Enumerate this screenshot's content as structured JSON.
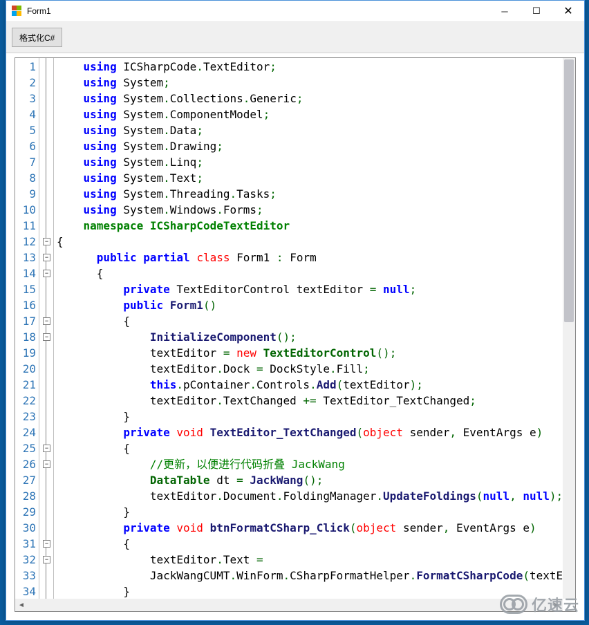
{
  "window": {
    "title": "Form1"
  },
  "toolbar": {
    "format_btn": "格式化C#"
  },
  "watermark": "亿速云",
  "line_numbers": [
    1,
    2,
    3,
    4,
    5,
    6,
    7,
    8,
    9,
    10,
    11,
    12,
    13,
    14,
    15,
    16,
    17,
    18,
    19,
    20,
    21,
    22,
    23,
    24,
    25,
    26,
    27,
    28,
    29,
    30,
    31,
    32,
    33,
    34
  ],
  "folds": [
    {
      "line": 12,
      "sym": "−"
    },
    {
      "line": 13,
      "sym": "−"
    },
    {
      "line": 14,
      "sym": "−"
    },
    {
      "line": 17,
      "sym": "−"
    },
    {
      "line": 18,
      "sym": "−"
    },
    {
      "line": 25,
      "sym": "−"
    },
    {
      "line": 26,
      "sym": "−"
    },
    {
      "line": 31,
      "sym": "−"
    },
    {
      "line": 32,
      "sym": "−"
    }
  ],
  "code": [
    [
      [
        "    "
      ],
      [
        "kw",
        "using"
      ],
      [
        " ICSharpCode"
      ],
      [
        "op",
        "."
      ],
      [
        "TextEditor"
      ],
      [
        "op",
        ";"
      ]
    ],
    [
      [
        "    "
      ],
      [
        "kw",
        "using"
      ],
      [
        " System"
      ],
      [
        "op",
        ";"
      ]
    ],
    [
      [
        "    "
      ],
      [
        "kw",
        "using"
      ],
      [
        " System"
      ],
      [
        "op",
        "."
      ],
      [
        "Collections"
      ],
      [
        "op",
        "."
      ],
      [
        "Generic"
      ],
      [
        "op",
        ";"
      ]
    ],
    [
      [
        "    "
      ],
      [
        "kw",
        "using"
      ],
      [
        " System"
      ],
      [
        "op",
        "."
      ],
      [
        "ComponentModel"
      ],
      [
        "op",
        ";"
      ]
    ],
    [
      [
        "    "
      ],
      [
        "kw",
        "using"
      ],
      [
        " System"
      ],
      [
        "op",
        "."
      ],
      [
        "Data"
      ],
      [
        "op",
        ";"
      ]
    ],
    [
      [
        "    "
      ],
      [
        "kw",
        "using"
      ],
      [
        " System"
      ],
      [
        "op",
        "."
      ],
      [
        "Drawing"
      ],
      [
        "op",
        ";"
      ]
    ],
    [
      [
        "    "
      ],
      [
        "kw",
        "using"
      ],
      [
        " System"
      ],
      [
        "op",
        "."
      ],
      [
        "Linq"
      ],
      [
        "op",
        ";"
      ]
    ],
    [
      [
        "    "
      ],
      [
        "kw",
        "using"
      ],
      [
        " System"
      ],
      [
        "op",
        "."
      ],
      [
        "Text"
      ],
      [
        "op",
        ";"
      ]
    ],
    [
      [
        "    "
      ],
      [
        "kw",
        "using"
      ],
      [
        " System"
      ],
      [
        "op",
        "."
      ],
      [
        "Threading"
      ],
      [
        "op",
        "."
      ],
      [
        "Tasks"
      ],
      [
        "op",
        ";"
      ]
    ],
    [
      [
        "    "
      ],
      [
        "kw",
        "using"
      ],
      [
        " System"
      ],
      [
        "op",
        "."
      ],
      [
        "Windows"
      ],
      [
        "op",
        "."
      ],
      [
        "Forms"
      ],
      [
        "op",
        ";"
      ]
    ],
    [
      [
        "    "
      ],
      [
        "ns",
        "namespace"
      ],
      [
        " "
      ],
      [
        "kw2",
        "ICSharpCodeTextEditor"
      ]
    ],
    [
      [
        "{"
      ]
    ],
    [
      [
        "      "
      ],
      [
        "kw",
        "public"
      ],
      [
        " "
      ],
      [
        "kw",
        "partial"
      ],
      [
        " "
      ],
      [
        "cls",
        "class"
      ],
      [
        " Form1 "
      ],
      [
        "op",
        ":"
      ],
      [
        " Form"
      ]
    ],
    [
      [
        "      {"
      ]
    ],
    [
      [
        "          "
      ],
      [
        "kw",
        "private"
      ],
      [
        " TextEditorControl textEditor "
      ],
      [
        "op",
        "="
      ],
      [
        " "
      ],
      [
        "kw",
        "null"
      ],
      [
        "op",
        ";"
      ]
    ],
    [
      [
        "          "
      ],
      [
        "kw",
        "public"
      ],
      [
        " "
      ],
      [
        "mtd",
        "Form1"
      ],
      [
        "op",
        "()"
      ]
    ],
    [
      [
        "          {"
      ]
    ],
    [
      [
        "              "
      ],
      [
        "mtd",
        "InitializeComponent"
      ],
      [
        "op",
        "();"
      ]
    ],
    [
      [
        "              textEditor "
      ],
      [
        "op",
        "="
      ],
      [
        " "
      ],
      [
        "cls",
        "new"
      ],
      [
        " "
      ],
      [
        "type",
        "TextEditorControl"
      ],
      [
        "op",
        "();"
      ]
    ],
    [
      [
        "              textEditor"
      ],
      [
        "op",
        "."
      ],
      [
        "Dock "
      ],
      [
        "op",
        "="
      ],
      [
        " DockStyle"
      ],
      [
        "op",
        "."
      ],
      [
        "Fill"
      ],
      [
        "op",
        ";"
      ]
    ],
    [
      [
        "              "
      ],
      [
        "kw",
        "this"
      ],
      [
        "op",
        "."
      ],
      [
        "pContainer"
      ],
      [
        "op",
        "."
      ],
      [
        "Controls"
      ],
      [
        "op",
        "."
      ],
      [
        "mtd",
        "Add"
      ],
      [
        "op",
        "("
      ],
      [
        "textEditor"
      ],
      [
        "op",
        ");"
      ]
    ],
    [
      [
        "              textEditor"
      ],
      [
        "op",
        "."
      ],
      [
        "TextChanged "
      ],
      [
        "op",
        "+="
      ],
      [
        " TextEditor_TextChanged"
      ],
      [
        "op",
        ";"
      ]
    ],
    [
      [
        "          }"
      ]
    ],
    [
      [
        "          "
      ],
      [
        "kw",
        "private"
      ],
      [
        " "
      ],
      [
        "cls",
        "void"
      ],
      [
        " "
      ],
      [
        "mtd",
        "TextEditor_TextChanged"
      ],
      [
        "op",
        "("
      ],
      [
        "cls",
        "object"
      ],
      [
        " sender"
      ],
      [
        "op",
        ","
      ],
      [
        " EventArgs e"
      ],
      [
        "op",
        ")"
      ]
    ],
    [
      [
        "          {"
      ]
    ],
    [
      [
        "              "
      ],
      [
        "cm",
        "//更新，以便进行代码折叠 JackWang"
      ]
    ],
    [
      [
        "              "
      ],
      [
        "type",
        "DataTable"
      ],
      [
        " dt "
      ],
      [
        "op",
        "="
      ],
      [
        " "
      ],
      [
        "mtd",
        "JackWang"
      ],
      [
        "op",
        "();"
      ]
    ],
    [
      [
        "              textEditor"
      ],
      [
        "op",
        "."
      ],
      [
        "Document"
      ],
      [
        "op",
        "."
      ],
      [
        "FoldingManager"
      ],
      [
        "op",
        "."
      ],
      [
        "mtd",
        "UpdateFoldings"
      ],
      [
        "op",
        "("
      ],
      [
        "kw",
        "null"
      ],
      [
        "op",
        ","
      ],
      [
        " "
      ],
      [
        "kw",
        "null"
      ],
      [
        "op",
        ");"
      ]
    ],
    [
      [
        "          }"
      ]
    ],
    [
      [
        "          "
      ],
      [
        "kw",
        "private"
      ],
      [
        " "
      ],
      [
        "cls",
        "void"
      ],
      [
        " "
      ],
      [
        "mtd",
        "btnFormatCSharp_Click"
      ],
      [
        "op",
        "("
      ],
      [
        "cls",
        "object"
      ],
      [
        " sender"
      ],
      [
        "op",
        ","
      ],
      [
        " EventArgs e"
      ],
      [
        "op",
        ")"
      ]
    ],
    [
      [
        "          {"
      ]
    ],
    [
      [
        "              textEditor"
      ],
      [
        "op",
        "."
      ],
      [
        "Text "
      ],
      [
        "op",
        "="
      ]
    ],
    [
      [
        "              JackWangCUMT"
      ],
      [
        "op",
        "."
      ],
      [
        "WinForm"
      ],
      [
        "op",
        "."
      ],
      [
        "CSharpFormatHelper"
      ],
      [
        "op",
        "."
      ],
      [
        "mtd",
        "FormatCSharpCode"
      ],
      [
        "op",
        "("
      ],
      [
        "textE"
      ]
    ],
    [
      [
        "          }"
      ]
    ]
  ]
}
